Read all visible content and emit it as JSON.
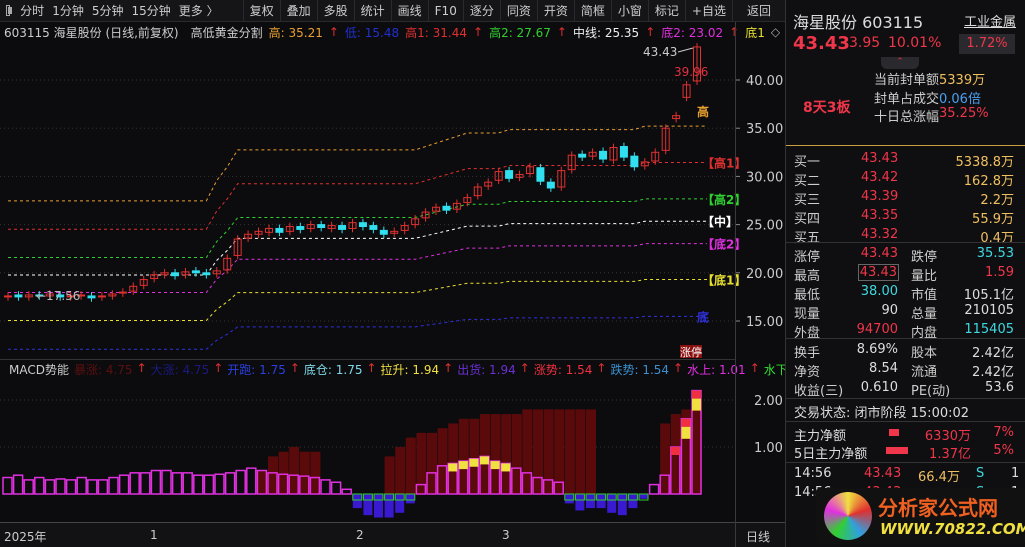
{
  "toolbar": {
    "periods": [
      "分时",
      "1分钟",
      "5分钟",
      "15分钟",
      "更多 〉"
    ],
    "buttons": [
      "复权",
      "叠加",
      "多股",
      "统计",
      "画线",
      "F10",
      "逐分",
      "同资",
      "开资",
      "简框",
      "小窗",
      "标记",
      "+自选",
      "返回"
    ]
  },
  "info": {
    "code_name": "603115 海星股份 (日线,前复权)",
    "indicator": "高低黄金分割",
    "high": "高: 35.21",
    "low": "低: 15.48",
    "high1": "高1: 31.44",
    "high2": "高2: 27.67",
    "mid": "中线: 25.35",
    "low2": "底2: 23.02",
    "low1": "底1"
  },
  "chart": {
    "price_ticks": [
      "40.00",
      "35.00",
      "30.00",
      "25.00",
      "20.00",
      "15.00"
    ],
    "max_label": "43.43",
    "last_label": "39.96",
    "min_label": "17.56",
    "band_labels": [
      "高",
      "【高1】",
      "【高2】",
      "【中】",
      "【底2】",
      "【底1】",
      "底"
    ],
    "badge": "涨停",
    "band_values": [
      35.21,
      31.44,
      27.67,
      25.35,
      23.02,
      19.3,
      15.48
    ],
    "band_colors": [
      "#e8a030",
      "#e03030",
      "#30d030",
      "#ffffff",
      "#e030e0",
      "#e8e030",
      "#3030e0"
    ],
    "band_scale": [
      0.78,
      0.78,
      0.78,
      0.78,
      0.78,
      0.78,
      0.78,
      0.78,
      0.78,
      0.78,
      0.78,
      0.78,
      0.78,
      0.78,
      0.78,
      0.78,
      0.78,
      0.78,
      0.78,
      0.78,
      0.84,
      0.88,
      0.93,
      0.93,
      0.93,
      0.93,
      0.93,
      0.93,
      0.93,
      0.93,
      0.93,
      0.93,
      0.93,
      0.93,
      0.93,
      0.93,
      0.93,
      0.93,
      0.93,
      0.93,
      0.94,
      0.95,
      0.96,
      0.97,
      0.98,
      0.98,
      0.98,
      0.98,
      0.99,
      0.99,
      0.99,
      0.99,
      0.99,
      0.99,
      0.99,
      0.99,
      0.99,
      0.99,
      0.99,
      0.99,
      0.99,
      1,
      1,
      1,
      1,
      1
    ],
    "closes": [
      17.6,
      17.5,
      17.7,
      17.6,
      17.8,
      17.5,
      17.6,
      17.7,
      17.4,
      17.6,
      17.8,
      18.0,
      18.6,
      19.3,
      19.8,
      20.0,
      19.7,
      20.1,
      20.0,
      19.8,
      20.2,
      21.5,
      23.5,
      24.0,
      24.3,
      24.6,
      24.2,
      24.8,
      24.5,
      25.0,
      24.7,
      24.9,
      24.5,
      25.2,
      24.8,
      24.5,
      24.0,
      24.3,
      24.9,
      25.6,
      26.3,
      26.8,
      26.5,
      27.2,
      27.8,
      28.9,
      29.4,
      30.5,
      29.8,
      30.2,
      31.0,
      29.5,
      28.8,
      30.6,
      32.2,
      32.0,
      32.5,
      31.8,
      33.0,
      32.0,
      31.0,
      31.5,
      32.5,
      35.0,
      36.3,
      39.5,
      43.43
    ],
    "opens": [
      17.5,
      17.7,
      17.5,
      17.7,
      17.6,
      17.7,
      17.5,
      17.6,
      17.6,
      17.5,
      17.6,
      17.9,
      18.1,
      18.7,
      19.4,
      19.8,
      20.0,
      19.8,
      20.2,
      20.0,
      19.9,
      20.3,
      21.8,
      23.6,
      24.0,
      24.2,
      24.6,
      24.3,
      24.8,
      24.6,
      25.0,
      24.6,
      24.9,
      24.6,
      25.2,
      24.9,
      24.4,
      24.1,
      24.4,
      25.0,
      25.7,
      26.4,
      26.9,
      26.6,
      27.3,
      28.0,
      29.0,
      29.6,
      30.6,
      29.9,
      30.3,
      30.9,
      29.4,
      28.9,
      30.7,
      32.3,
      32.1,
      32.6,
      31.7,
      33.1,
      32.1,
      31.1,
      31.6,
      32.7,
      36.0,
      38.2,
      39.9
    ]
  },
  "macd": {
    "title": "MACD势能",
    "items": [
      {
        "label": "暴涨: 4.75",
        "color": "#5a1010"
      },
      {
        "label": "大涨: 4.75",
        "color": "#1a1a80"
      },
      {
        "label": "开跑: 1.75",
        "color": "#2a40e0"
      },
      {
        "label": "底仓: 1.75",
        "color": "#7fd8e8"
      },
      {
        "label": "拉升: 1.94",
        "color": "#f0e040"
      },
      {
        "label": "出货: 1.94",
        "color": "#6a30d0"
      },
      {
        "label": "涨势: 1.54",
        "color": "#f03040"
      },
      {
        "label": "跌势: 1.54",
        "color": "#3a90d0"
      },
      {
        "label": "水上: 1.01",
        "color": "#e030e0"
      },
      {
        "label": "水下",
        "color": "#30e030"
      }
    ],
    "ticks": [
      "2.00",
      "1.00"
    ],
    "values": [
      0.35,
      0.4,
      0.3,
      0.35,
      0.3,
      0.32,
      0.3,
      0.35,
      0.3,
      0.3,
      0.35,
      0.4,
      0.45,
      0.45,
      0.5,
      0.5,
      0.45,
      0.45,
      0.4,
      0.4,
      0.42,
      0.45,
      0.5,
      0.55,
      0.5,
      0.45,
      0.42,
      0.4,
      0.38,
      0.35,
      0.3,
      0.25,
      0.1,
      -0.3,
      -0.45,
      -0.5,
      -0.5,
      -0.4,
      -0.2,
      0.2,
      0.45,
      0.6,
      0.65,
      0.7,
      0.75,
      0.8,
      0.7,
      0.65,
      0.55,
      0.45,
      0.35,
      0.3,
      0.25,
      -0.2,
      -0.35,
      -0.3,
      -0.3,
      -0.4,
      -0.45,
      -0.3,
      -0.1,
      0.2,
      0.4,
      1.0,
      1.6,
      2.2
    ],
    "shadow": [
      0,
      0,
      0,
      0,
      0,
      0,
      0,
      0,
      0,
      0,
      0,
      0,
      0,
      0,
      0,
      0,
      0,
      0,
      0,
      0,
      0,
      0,
      0,
      0,
      0.5,
      0.8,
      0.9,
      1.0,
      0.9,
      0.9,
      0,
      0,
      0,
      0,
      0,
      0,
      0.8,
      1.0,
      1.2,
      1.3,
      1.3,
      1.4,
      1.5,
      1.6,
      1.6,
      1.7,
      1.7,
      1.7,
      1.7,
      1.8,
      1.8,
      1.8,
      1.8,
      1.8,
      1.8,
      1.8,
      0,
      0,
      0,
      0,
      0,
      0,
      1.5,
      1.7,
      1.8,
      2.0
    ]
  },
  "axis": {
    "labels": [
      "2025年",
      "1",
      "2",
      "3"
    ],
    "period": "日线"
  },
  "panel": {
    "name_code": "海星股份 603115",
    "sector": "工业金属",
    "sector_pct": "1.72%",
    "price": "43.43",
    "change": "3.95",
    "pct": "10.01%",
    "streak": "8天3板",
    "seal": [
      {
        "k": "当前封单额",
        "v": "5339万"
      },
      {
        "k": "封单占成交",
        "v": "0.06倍"
      },
      {
        "k": "十日总涨幅",
        "v": "35.25%"
      }
    ],
    "bids": [
      [
        "买一",
        "43.43",
        "5338.8万"
      ],
      [
        "买二",
        "43.42",
        "162.8万"
      ],
      [
        "买三",
        "43.39",
        "2.2万"
      ],
      [
        "买四",
        "43.35",
        "55.9万"
      ],
      [
        "买五",
        "43.32",
        "0.4万"
      ]
    ],
    "stats": [
      [
        "涨停",
        "43.43",
        "跌停",
        "35.53"
      ],
      [
        "最高",
        "43.43",
        "量比",
        "1.59"
      ],
      [
        "最低",
        "38.00",
        "市值",
        "105.1亿"
      ],
      [
        "现量",
        "90",
        "总量",
        "210105"
      ],
      [
        "外盘",
        "94700",
        "内盘",
        "115405"
      ]
    ],
    "stats2": [
      [
        "换手",
        "8.69%",
        "股本",
        "2.42亿"
      ],
      [
        "净资",
        "8.54",
        "流通",
        "2.42亿"
      ],
      [
        "收益(三)",
        "0.610",
        "PE(动)",
        "53.6"
      ]
    ],
    "status": "交易状态: 闭市阶段 15:00:02",
    "flows": [
      [
        "主力净额",
        "6330万",
        "7%"
      ],
      [
        "5日主力净额",
        "1.37亿",
        "5%"
      ]
    ],
    "ticks": [
      [
        "14:56",
        "43.43",
        "66.4万",
        "S",
        "1"
      ],
      [
        "14:56",
        "43.43",
        "21.7万",
        "S",
        "1"
      ]
    ],
    "logo_text": "分析家公式网",
    "logo_url": "WWW.70822.COM"
  }
}
